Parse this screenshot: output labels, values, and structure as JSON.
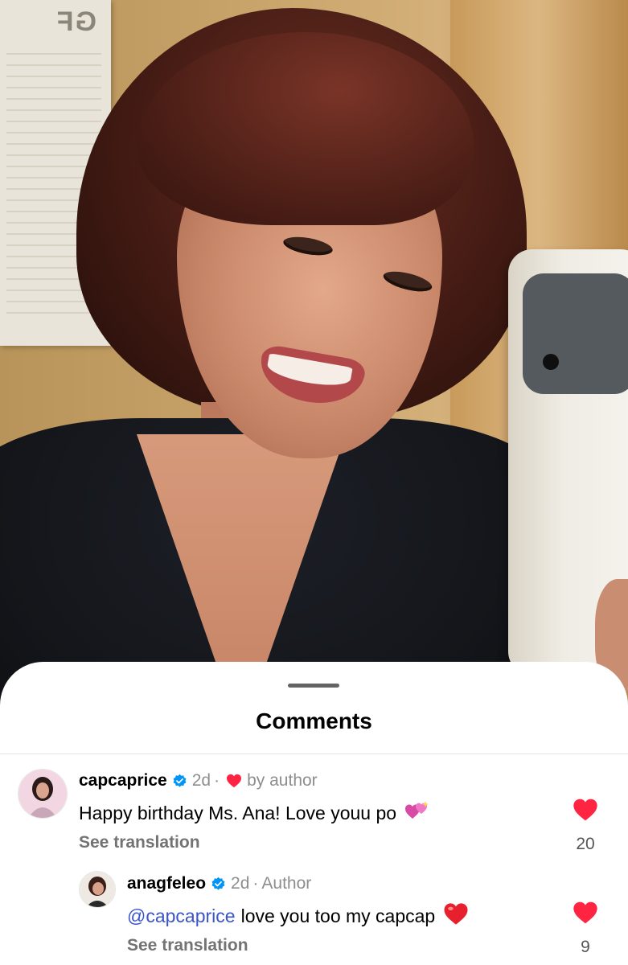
{
  "colors": {
    "heart_red": "#ff2442",
    "verified_blue": "#0095f6",
    "mention_blue": "#3a55c9",
    "meta_gray": "#8e8e8e"
  },
  "photo": {
    "poster_text": "GF"
  },
  "sheet": {
    "title": "Comments"
  },
  "comments": [
    {
      "username": "capcaprice",
      "verified": true,
      "time": "2d",
      "author_badge": "by author",
      "text": "Happy birthday Ms. Ana! Love youu po",
      "emoji": "💞",
      "see_translation": "See translation",
      "likes": "20",
      "avatar_icon": "profile-photo-icon"
    },
    {
      "username": "anagfeleo",
      "verified": true,
      "time": "2d",
      "author_badge": "Author",
      "mention": "@capcaprice",
      "text": "love you too my capcap",
      "emoji": "❤️",
      "see_translation": "See translation",
      "likes": "9",
      "avatar_icon": "profile-photo-icon"
    }
  ]
}
